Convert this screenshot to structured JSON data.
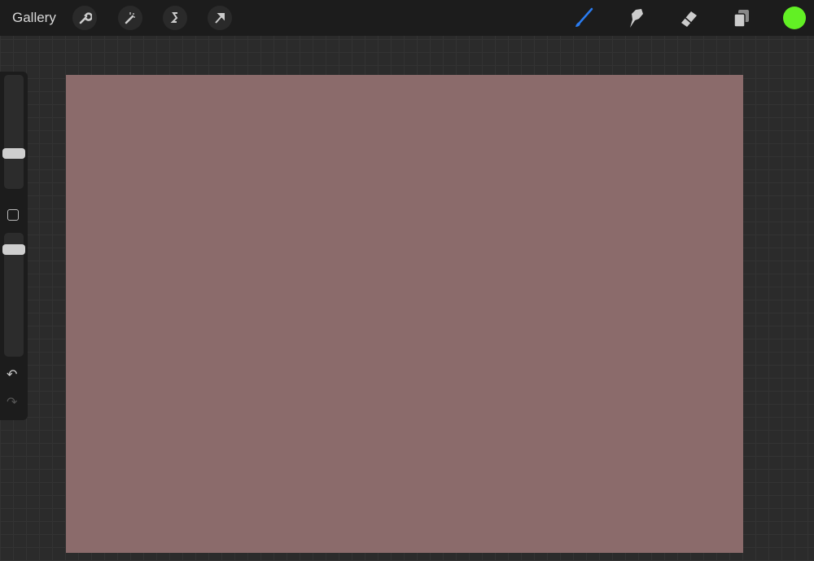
{
  "topbar": {
    "gallery_label": "Gallery"
  },
  "colors": {
    "active_color": "#62f024",
    "brush_accent": "#2a7cf0",
    "canvas_bg": "#8b6b6b"
  },
  "tools_left": [
    "wrench-icon",
    "magic-wand-icon",
    "selection-icon",
    "transform-arrow-icon"
  ],
  "tools_right": [
    "brush-icon",
    "smudge-icon",
    "eraser-icon",
    "layers-icon"
  ]
}
